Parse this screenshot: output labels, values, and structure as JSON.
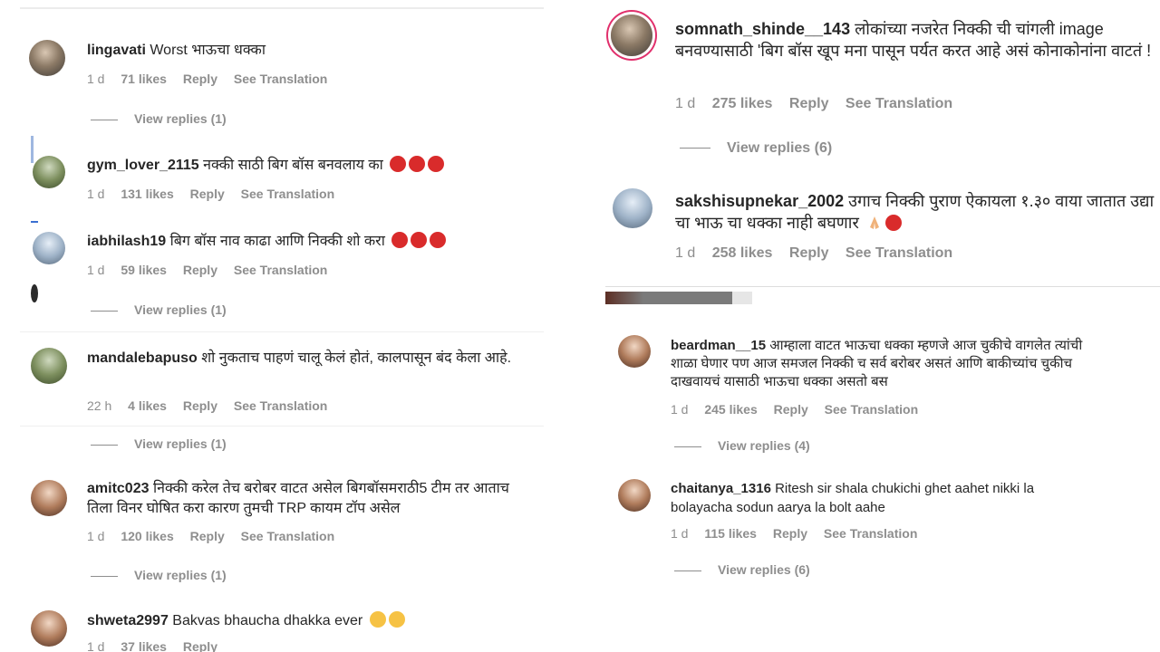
{
  "left": {
    "comments": [
      {
        "user": "lingavati",
        "text": "Worst भाऊचा धक्का",
        "time": "1 d",
        "likes": "71 likes",
        "reply": "Reply",
        "translate": "See Translation",
        "view_replies": "View replies (1)"
      },
      {
        "user": "gym_lover_2115",
        "text": "नक्की साठी बिग बॉस बनवलाय का",
        "time": "1 d",
        "likes": "131 likes",
        "reply": "Reply",
        "translate": "See Translation"
      },
      {
        "user": "iabhilash19",
        "text": "बिग बॉस नाव काढा आणि निक्की शो करा",
        "time": "1 d",
        "likes": "59 likes",
        "reply": "Reply",
        "translate": "See Translation",
        "view_replies": "View replies (1)"
      },
      {
        "user": "mandalebapuso",
        "text": "शो नुकताच पाहणं चालू केलं होतं, कालपासून बंद केला आहे.",
        "time": "22 h",
        "likes": "4 likes",
        "reply": "Reply",
        "translate": "See Translation",
        "view_replies": "View replies (1)"
      },
      {
        "user": "amitc023",
        "text": "निक्की करेल तेच बरोबर वाटत असेल बिगबॉसमराठी5 टीम तर आताच तिला विनर घोषित करा कारण तुमची TRP कायम टॉप असेल",
        "time": "1 d",
        "likes": "120 likes",
        "reply": "Reply",
        "translate": "See Translation",
        "view_replies": "View replies (1)"
      },
      {
        "user": "shweta2997",
        "text": "Bakvas bhaucha dhakka ever",
        "time": "1 d",
        "likes": "37 likes",
        "reply": "Reply"
      }
    ]
  },
  "right": {
    "comments": [
      {
        "user": "somnath_shinde__143",
        "text": "लोकांच्या नजरेत निक्की ची चांगली image बनवण्यासाठी 'बिग बॉस खूप मना पासून पर्यत करत आहे असं कोनाकोनांना वाटतं !",
        "time": "1 d",
        "likes": "275 likes",
        "reply": "Reply",
        "translate": "See Translation",
        "view_replies": "View replies (6)"
      },
      {
        "user": "sakshisupnekar_2002",
        "text": "उगाच निक्की पुराण ऐकायला १.३० वाया जातात उद्या चा भाऊ चा धक्का नाही बघणार",
        "time": "1 d",
        "likes": "258 likes",
        "reply": "Reply",
        "translate": "See Translation"
      },
      {
        "user": "beardman__15",
        "text": "आम्हाला वाटत भाऊचा धक्का म्हणजे आज चुकीचे वागलेत त्यांची शाळा घेणार पण आज समजल निक्की च सर्व बरोबर असतं आणि बाकीच्यांच चुकीच दाखवायचं यासाठी भाऊचा धक्का असतो बस",
        "time": "1 d",
        "likes": "245 likes",
        "reply": "Reply",
        "translate": "See Translation",
        "view_replies": "View replies (4)"
      },
      {
        "user": "chaitanya_1316",
        "text": "Ritesh sir shala chukichi ghet aahet nikki la bolayacha sodun aarya la bolt aahe",
        "time": "1 d",
        "likes": "115 likes",
        "reply": "Reply",
        "translate": "See Translation",
        "view_replies": "View replies (6)"
      }
    ]
  },
  "colors": {
    "text": "#262626",
    "meta": "#8e8e8e",
    "ring": "#e1306c",
    "angry": "#d92b2b",
    "yellow": "#f6c244"
  }
}
